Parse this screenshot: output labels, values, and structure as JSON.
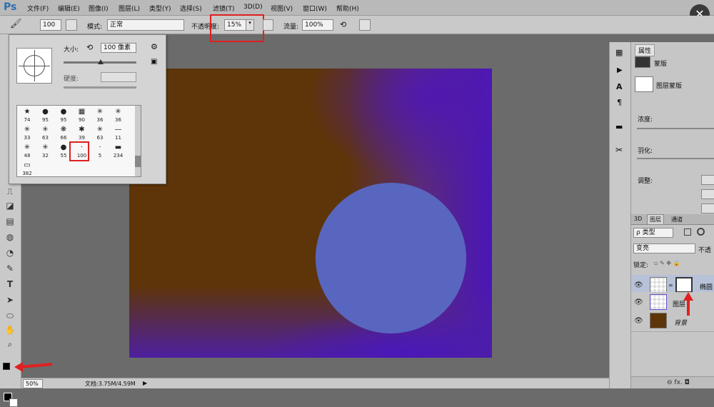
{
  "menubar": {
    "logo": "Ps",
    "items": [
      "文件(F)",
      "编辑(E)",
      "图像(I)",
      "图层(L)",
      "类型(Y)",
      "选择(S)",
      "滤镜(T)",
      "3D(D)",
      "视图(V)",
      "窗口(W)",
      "帮助(H)"
    ]
  },
  "options": {
    "brush_size": "100",
    "mode_label": "模式:",
    "mode_value": "正常",
    "opacity_label": "不透明度:",
    "opacity_value": "15%",
    "flow_label": "流量:",
    "flow_value": "100%"
  },
  "brush_panel": {
    "size_label": "大小:",
    "size_value": "100 像素",
    "hardness_label": "硬度:",
    "presets": [
      {
        "glyph": "★",
        "size": "74"
      },
      {
        "glyph": "●",
        "size": "95"
      },
      {
        "glyph": "●",
        "size": "95"
      },
      {
        "glyph": "▦",
        "size": "90"
      },
      {
        "glyph": "✳",
        "size": "36"
      },
      {
        "glyph": "✳",
        "size": "36"
      },
      {
        "glyph": "✳",
        "size": "33"
      },
      {
        "glyph": "✳",
        "size": "63"
      },
      {
        "glyph": "❋",
        "size": "66"
      },
      {
        "glyph": "✱",
        "size": "39"
      },
      {
        "glyph": "✳",
        "size": "63"
      },
      {
        "glyph": "—",
        "size": "11"
      },
      {
        "glyph": "✳",
        "size": "48"
      },
      {
        "glyph": "✳",
        "size": "32"
      },
      {
        "glyph": "●",
        "size": "55"
      },
      {
        "glyph": "·",
        "size": "100"
      },
      {
        "glyph": "·",
        "size": "5"
      },
      {
        "glyph": "▬",
        "size": "234"
      },
      {
        "glyph": "▭",
        "size": "382"
      }
    ]
  },
  "right_panel": {
    "tab": "属性",
    "mask_label": "蒙版",
    "layer_mask_label": "图层蒙版",
    "density_label": "浓度:",
    "feather_label": "羽化:",
    "adjust_label": "调整:"
  },
  "layers_panel": {
    "tabs": [
      "3D",
      "图层",
      "通道"
    ],
    "filter_kind": "类型",
    "blend_mode": "变亮",
    "opacity_short": "不透",
    "lock_label": "锁定:",
    "layers": [
      {
        "name": "椭圆"
      },
      {
        "name": "图层"
      },
      {
        "name": "背景"
      }
    ],
    "footer_icons": "⊖  fx.  ◘"
  },
  "statusbar": {
    "zoom": "50%",
    "doc_info": "文档:3.75M/4.59M"
  },
  "colors": {
    "canvas_brown": "#5e3508",
    "canvas_purple": "#4a16b8",
    "circle_fill": "#5866bf",
    "highlight_red": "#e02020"
  }
}
